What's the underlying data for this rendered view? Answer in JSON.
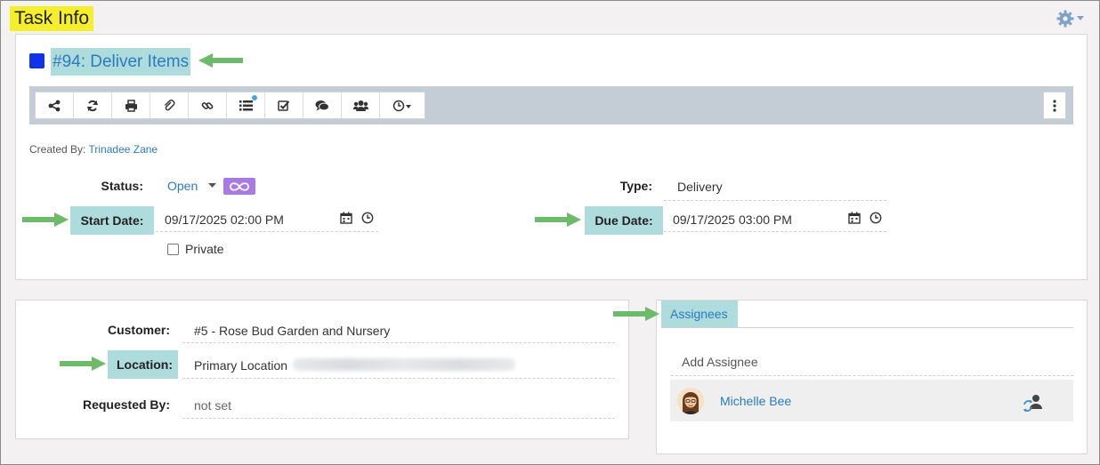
{
  "header": {
    "title": "Task Info"
  },
  "task": {
    "title": "#94: Deliver Items",
    "color": "#1033e8",
    "created_by_label": "Created By:",
    "created_by_name": "Trinadee Zane"
  },
  "toolbar": {
    "buttons": [
      "share-icon",
      "refresh-icon",
      "print-icon",
      "paperclip-icon",
      "link-icon",
      "list-icon",
      "checkbox-icon",
      "comments-icon",
      "users-icon",
      "clock-dropdown-icon"
    ],
    "more": "vertical-ellipsis-icon"
  },
  "fields": {
    "status_label": "Status:",
    "status_value": "Open",
    "type_label": "Type:",
    "type_value": "Delivery",
    "start_label": "Start Date:",
    "start_value": "09/17/2025 02:00 PM",
    "due_label": "Due Date:",
    "due_value": "09/17/2025 03:00 PM",
    "private_label": "Private"
  },
  "customer": {
    "customer_label": "Customer:",
    "customer_value": "#5 - Rose Bud Garden and Nursery",
    "location_label": "Location:",
    "location_value": "Primary Location",
    "requested_label": "Requested By:",
    "requested_value": "not set"
  },
  "assignees": {
    "tab_label": "Assignees",
    "add_placeholder": "Add Assignee",
    "items": [
      {
        "name": "Michelle Bee"
      }
    ]
  },
  "colors": {
    "highlight": "#aedbdc",
    "title_highlight": "#f5ee2a",
    "link": "#2c7bbf",
    "arrow": "#6dbb6a",
    "status_badge": "#a77ae6"
  }
}
